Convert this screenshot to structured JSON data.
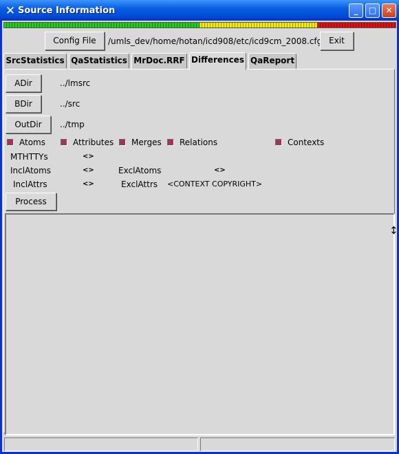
{
  "window": {
    "title": "Source Information"
  },
  "toolbar": {
    "config_label": "Config File",
    "config_path": "/umls_dev/home/hotan/icd908/etc/icd9cm_2008.cfg",
    "exit_label": "Exit"
  },
  "tabs": [
    {
      "label": "SrcStatistics"
    },
    {
      "label": "QaStatistics"
    },
    {
      "label": "MrDoc.RRF"
    },
    {
      "label": "Differences"
    },
    {
      "label": "QaReport"
    }
  ],
  "active_tab": "Differences",
  "dirs": {
    "adir_label": "ADir",
    "adir_value": "../lmsrc",
    "bdir_label": "BDir",
    "bdir_value": "../src",
    "outdir_label": "OutDir",
    "outdir_value": "../tmp"
  },
  "checkboxes": [
    {
      "label": "Atoms",
      "checked": true
    },
    {
      "label": "Attributes",
      "checked": true
    },
    {
      "label": "Merges",
      "checked": true
    },
    {
      "label": "Relations",
      "checked": true
    },
    {
      "label": "Contexts",
      "checked": true
    }
  ],
  "params": {
    "mthttys_label": "MTHTTYs",
    "mthttys_value": "<>",
    "inclatoms_label": "InclAtoms",
    "inclatoms_value": "<>",
    "exclatoms_label": "ExclAtoms",
    "exclatoms_value": "<>",
    "inclattrs_label": "InclAttrs",
    "inclattrs_value": "<>",
    "exclattrs_label": "ExclAttrs",
    "exclattrs_value": "<CONTEXT COPYRIGHT>"
  },
  "process_label": "Process",
  "colors": {
    "checkbox": "#a0345a",
    "titlebar": "#0a5fe0",
    "meter_green": "#22cc22",
    "meter_yellow": "#eeee00",
    "meter_red": "#dd1111"
  }
}
